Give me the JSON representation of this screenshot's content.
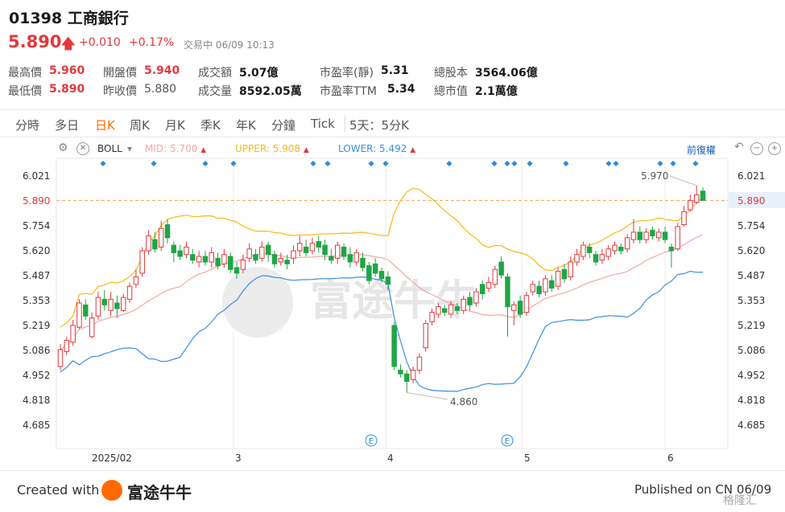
{
  "header": {
    "code": "01398",
    "name": "工商銀行",
    "price": "5.890",
    "change": "+0.010",
    "change_pct": "+0.17%",
    "status": "交易中 06/09 10:13"
  },
  "stats": {
    "high_label": "最高價",
    "high": "5.960",
    "low_label": "最低價",
    "low": "5.890",
    "open_label": "開盤價",
    "open": "5.940",
    "prev_label": "昨收價",
    "prev": "5.880",
    "turnover_label": "成交額",
    "turnover": "5.07億",
    "volume_label": "成交量",
    "volume": "8592.05萬",
    "pe_static_label": "市盈率(靜)",
    "pe_static": "5.31",
    "pe_ttm_label": "市盈率TTM",
    "pe_ttm": "5.34",
    "shares_label": "總股本",
    "shares": "3564.06億",
    "mktcap_label": "總市值",
    "mktcap": "2.1萬億"
  },
  "tabs": [
    "分時",
    "多日",
    "日K",
    "周K",
    "月K",
    "季K",
    "年K",
    "分鐘",
    "Tick"
  ],
  "active_tab": "日K",
  "range_tab": "5天：5分K",
  "indicator": {
    "name": "BOLL",
    "mid_label": "MID:",
    "mid": "5.700",
    "upper_label": "UPPER:",
    "upper": "5.908",
    "lower_label": "LOWER:",
    "lower": "5.492",
    "adjust": "前復權"
  },
  "watermark": "富途牛牛",
  "footer": {
    "created_with": "Created with",
    "brand": "富途牛牛",
    "published": "Published on CN 06/09",
    "stamp": "格隆汇"
  },
  "colors": {
    "up": "#e2383c",
    "down": "#1fa645",
    "mid_line": "#f2a6a6",
    "upper_line": "#f7b916",
    "lower_line": "#3c8ee6",
    "prev_close_line": "#f0a050",
    "event_marker": "#2b8ae0"
  },
  "chart_data": {
    "type": "candlestick",
    "yticks": [
      "6.021",
      "5.890",
      "5.754",
      "5.620",
      "5.487",
      "5.353",
      "5.219",
      "5.086",
      "4.952",
      "4.818",
      "4.685"
    ],
    "ylim": [
      4.64,
      6.08
    ],
    "xticks": [
      "2025/02",
      "3",
      "4",
      "5",
      "6"
    ],
    "current_price": 5.89,
    "annotations": [
      {
        "label": "5.970",
        "value": 5.97
      },
      {
        "label": "4.860",
        "value": 4.86
      }
    ],
    "event_markers": [
      "E",
      "E"
    ],
    "candles": [
      {
        "o": 5.0,
        "c": 5.09,
        "h": 5.12,
        "l": 4.98
      },
      {
        "o": 5.08,
        "c": 5.14,
        "h": 5.16,
        "l": 5.06
      },
      {
        "o": 5.13,
        "c": 5.22,
        "h": 5.25,
        "l": 5.11
      },
      {
        "o": 5.21,
        "c": 5.34,
        "h": 5.36,
        "l": 5.2
      },
      {
        "o": 5.33,
        "c": 5.27,
        "h": 5.36,
        "l": 5.25
      },
      {
        "o": 5.16,
        "c": 5.26,
        "h": 5.29,
        "l": 5.15
      },
      {
        "o": 5.27,
        "c": 5.37,
        "h": 5.4,
        "l": 5.25
      },
      {
        "o": 5.36,
        "c": 5.33,
        "h": 5.41,
        "l": 5.3
      },
      {
        "o": 5.3,
        "c": 5.36,
        "h": 5.4,
        "l": 5.27
      },
      {
        "o": 5.34,
        "c": 5.31,
        "h": 5.38,
        "l": 5.26
      },
      {
        "o": 5.3,
        "c": 5.37,
        "h": 5.39,
        "l": 5.29
      },
      {
        "o": 5.36,
        "c": 5.43,
        "h": 5.45,
        "l": 5.34
      },
      {
        "o": 5.44,
        "c": 5.48,
        "h": 5.52,
        "l": 5.42
      },
      {
        "o": 5.5,
        "c": 5.62,
        "h": 5.64,
        "l": 5.48
      },
      {
        "o": 5.62,
        "c": 5.7,
        "h": 5.73,
        "l": 5.6
      },
      {
        "o": 5.68,
        "c": 5.63,
        "h": 5.72,
        "l": 5.61
      },
      {
        "o": 5.64,
        "c": 5.74,
        "h": 5.78,
        "l": 5.62
      },
      {
        "o": 5.76,
        "c": 5.69,
        "h": 5.79,
        "l": 5.66
      },
      {
        "o": 5.65,
        "c": 5.61,
        "h": 5.67,
        "l": 5.56
      },
      {
        "o": 5.62,
        "c": 5.59,
        "h": 5.65,
        "l": 5.57
      },
      {
        "o": 5.6,
        "c": 5.64,
        "h": 5.67,
        "l": 5.58
      },
      {
        "o": 5.6,
        "c": 5.57,
        "h": 5.63,
        "l": 5.55
      },
      {
        "o": 5.56,
        "c": 5.59,
        "h": 5.62,
        "l": 5.53
      },
      {
        "o": 5.59,
        "c": 5.56,
        "h": 5.62,
        "l": 5.54
      },
      {
        "o": 5.56,
        "c": 5.61,
        "h": 5.64,
        "l": 5.53
      },
      {
        "o": 5.58,
        "c": 5.54,
        "h": 5.61,
        "l": 5.52
      },
      {
        "o": 5.55,
        "c": 5.6,
        "h": 5.63,
        "l": 5.53
      },
      {
        "o": 5.59,
        "c": 5.52,
        "h": 5.61,
        "l": 5.5
      },
      {
        "o": 5.53,
        "c": 5.5,
        "h": 5.56,
        "l": 5.47
      },
      {
        "o": 5.52,
        "c": 5.57,
        "h": 5.6,
        "l": 5.5
      },
      {
        "o": 5.58,
        "c": 5.63,
        "h": 5.66,
        "l": 5.56
      },
      {
        "o": 5.6,
        "c": 5.57,
        "h": 5.63,
        "l": 5.55
      },
      {
        "o": 5.58,
        "c": 5.64,
        "h": 5.67,
        "l": 5.56
      },
      {
        "o": 5.65,
        "c": 5.6,
        "h": 5.67,
        "l": 5.56
      },
      {
        "o": 5.6,
        "c": 5.55,
        "h": 5.62,
        "l": 5.53
      },
      {
        "o": 5.56,
        "c": 5.58,
        "h": 5.61,
        "l": 5.54
      },
      {
        "o": 5.57,
        "c": 5.55,
        "h": 5.6,
        "l": 5.52
      },
      {
        "o": 5.58,
        "c": 5.62,
        "h": 5.65,
        "l": 5.55
      },
      {
        "o": 5.62,
        "c": 5.66,
        "h": 5.7,
        "l": 5.59
      },
      {
        "o": 5.64,
        "c": 5.61,
        "h": 5.68,
        "l": 5.59
      },
      {
        "o": 5.62,
        "c": 5.66,
        "h": 5.69,
        "l": 5.6
      },
      {
        "o": 5.67,
        "c": 5.64,
        "h": 5.7,
        "l": 5.61
      },
      {
        "o": 5.65,
        "c": 5.6,
        "h": 5.68,
        "l": 5.57
      },
      {
        "o": 5.59,
        "c": 5.57,
        "h": 5.63,
        "l": 5.55
      },
      {
        "o": 5.58,
        "c": 5.65,
        "h": 5.67,
        "l": 5.55
      },
      {
        "o": 5.64,
        "c": 5.59,
        "h": 5.66,
        "l": 5.57
      },
      {
        "o": 5.6,
        "c": 5.56,
        "h": 5.64,
        "l": 5.53
      },
      {
        "o": 5.56,
        "c": 5.61,
        "h": 5.63,
        "l": 5.54
      },
      {
        "o": 5.58,
        "c": 5.53,
        "h": 5.61,
        "l": 5.51
      },
      {
        "o": 5.54,
        "c": 5.46,
        "h": 5.56,
        "l": 5.44
      },
      {
        "o": 5.55,
        "c": 5.5,
        "h": 5.58,
        "l": 5.48
      },
      {
        "o": 5.51,
        "c": 5.47,
        "h": 5.53,
        "l": 5.45
      },
      {
        "o": 5.48,
        "c": 5.44,
        "h": 5.51,
        "l": 5.41
      },
      {
        "o": 5.22,
        "c": 5.0,
        "h": 5.24,
        "l": 4.98
      },
      {
        "o": 4.98,
        "c": 4.96,
        "h": 5.01,
        "l": 4.94
      },
      {
        "o": 4.96,
        "c": 4.92,
        "h": 4.98,
        "l": 4.86
      },
      {
        "o": 4.93,
        "c": 4.98,
        "h": 5.0,
        "l": 4.91
      },
      {
        "o": 4.98,
        "c": 5.05,
        "h": 5.07,
        "l": 4.96
      },
      {
        "o": 5.1,
        "c": 5.23,
        "h": 5.25,
        "l": 5.08
      },
      {
        "o": 5.24,
        "c": 5.29,
        "h": 5.31,
        "l": 5.22
      },
      {
        "o": 5.28,
        "c": 5.32,
        "h": 5.34,
        "l": 5.26
      },
      {
        "o": 5.31,
        "c": 5.29,
        "h": 5.33,
        "l": 5.27
      },
      {
        "o": 5.28,
        "c": 5.33,
        "h": 5.35,
        "l": 5.26
      },
      {
        "o": 5.32,
        "c": 5.3,
        "h": 5.34,
        "l": 5.28
      },
      {
        "o": 5.3,
        "c": 5.36,
        "h": 5.38,
        "l": 5.28
      },
      {
        "o": 5.37,
        "c": 5.33,
        "h": 5.4,
        "l": 5.3
      },
      {
        "o": 5.34,
        "c": 5.4,
        "h": 5.42,
        "l": 5.32
      },
      {
        "o": 5.44,
        "c": 5.39,
        "h": 5.46,
        "l": 5.36
      },
      {
        "o": 5.42,
        "c": 5.45,
        "h": 5.48,
        "l": 5.4
      },
      {
        "o": 5.44,
        "c": 5.52,
        "h": 5.54,
        "l": 5.42
      },
      {
        "o": 5.56,
        "c": 5.49,
        "h": 5.59,
        "l": 5.47
      },
      {
        "o": 5.48,
        "c": 5.32,
        "h": 5.5,
        "l": 5.16
      },
      {
        "o": 5.3,
        "c": 5.33,
        "h": 5.35,
        "l": 5.22
      },
      {
        "o": 5.35,
        "c": 5.28,
        "h": 5.38,
        "l": 5.26
      },
      {
        "o": 5.29,
        "c": 5.38,
        "h": 5.4,
        "l": 5.27
      },
      {
        "o": 5.4,
        "c": 5.44,
        "h": 5.46,
        "l": 5.38
      },
      {
        "o": 5.43,
        "c": 5.39,
        "h": 5.46,
        "l": 5.37
      },
      {
        "o": 5.4,
        "c": 5.47,
        "h": 5.49,
        "l": 5.38
      },
      {
        "o": 5.46,
        "c": 5.42,
        "h": 5.49,
        "l": 5.4
      },
      {
        "o": 5.43,
        "c": 5.51,
        "h": 5.53,
        "l": 5.41
      },
      {
        "o": 5.52,
        "c": 5.47,
        "h": 5.55,
        "l": 5.45
      },
      {
        "o": 5.48,
        "c": 5.56,
        "h": 5.59,
        "l": 5.46
      },
      {
        "o": 5.56,
        "c": 5.6,
        "h": 5.63,
        "l": 5.54
      },
      {
        "o": 5.59,
        "c": 5.65,
        "h": 5.67,
        "l": 5.57
      },
      {
        "o": 5.64,
        "c": 5.61,
        "h": 5.66,
        "l": 5.58
      },
      {
        "o": 5.6,
        "c": 5.56,
        "h": 5.62,
        "l": 5.54
      },
      {
        "o": 5.57,
        "c": 5.6,
        "h": 5.63,
        "l": 5.55
      },
      {
        "o": 5.59,
        "c": 5.63,
        "h": 5.65,
        "l": 5.57
      },
      {
        "o": 5.62,
        "c": 5.65,
        "h": 5.67,
        "l": 5.6
      },
      {
        "o": 5.64,
        "c": 5.62,
        "h": 5.66,
        "l": 5.6
      },
      {
        "o": 5.63,
        "c": 5.69,
        "h": 5.71,
        "l": 5.61
      },
      {
        "o": 5.68,
        "c": 5.72,
        "h": 5.79,
        "l": 5.66
      },
      {
        "o": 5.72,
        "c": 5.68,
        "h": 5.75,
        "l": 5.66
      },
      {
        "o": 5.68,
        "c": 5.72,
        "h": 5.74,
        "l": 5.66
      },
      {
        "o": 5.73,
        "c": 5.7,
        "h": 5.75,
        "l": 5.68
      },
      {
        "o": 5.69,
        "c": 5.72,
        "h": 5.74,
        "l": 5.67
      },
      {
        "o": 5.72,
        "c": 5.68,
        "h": 5.75,
        "l": 5.66
      },
      {
        "o": 5.64,
        "c": 5.62,
        "h": 5.66,
        "l": 5.53
      },
      {
        "o": 5.63,
        "c": 5.75,
        "h": 5.77,
        "l": 5.62
      },
      {
        "o": 5.76,
        "c": 5.83,
        "h": 5.86,
        "l": 5.75
      },
      {
        "o": 5.84,
        "c": 5.89,
        "h": 5.92,
        "l": 5.83
      },
      {
        "o": 5.88,
        "c": 5.92,
        "h": 5.97,
        "l": 5.87
      },
      {
        "o": 5.94,
        "c": 5.89,
        "h": 5.96,
        "l": 5.89
      }
    ]
  }
}
